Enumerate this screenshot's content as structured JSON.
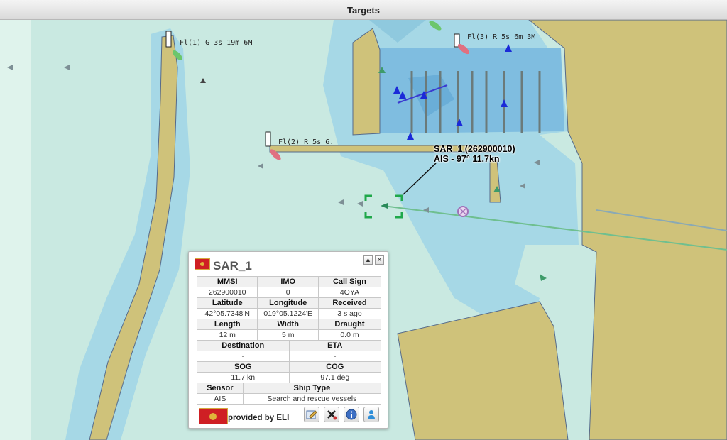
{
  "window": {
    "title": "Targets"
  },
  "map": {
    "light_labels": [
      "Fl(1) G 3s 19m 6M",
      "Fl(3) R 5s 6m 3M",
      "Fl(2) R 5s 6."
    ],
    "target_callout": {
      "line1": "SAR_1 (262900010)",
      "line2": "AIS - 97° 11.7kn"
    }
  },
  "panel": {
    "vessel_name": "SAR_1",
    "rows": [
      {
        "headers": [
          "MMSI",
          "IMO",
          "Call Sign"
        ],
        "values": [
          "262900010",
          "0",
          "4OYA"
        ]
      },
      {
        "headers": [
          "Latitude",
          "Longitude",
          "Received"
        ],
        "values": [
          "42°05.7348'N",
          "019°05.1224'E",
          "3 s ago"
        ]
      },
      {
        "headers": [
          "Length",
          "Width",
          "Draught"
        ],
        "values": [
          "12 m",
          "5 m",
          "0.0 m"
        ]
      },
      {
        "headers": [
          "Destination",
          "ETA"
        ],
        "values": [
          "-",
          "-"
        ]
      },
      {
        "headers": [
          "SOG",
          "COG"
        ],
        "values": [
          "11.7 kn",
          "97.1 deg"
        ]
      },
      {
        "headers": [
          "Sensor",
          "Ship Type"
        ],
        "values": [
          "AIS",
          "Search and rescue vessels"
        ]
      }
    ],
    "footer": {
      "provided_text": "provided by ELI"
    },
    "colors": {
      "flag_red": "#cf1f24",
      "flag_gold": "#e0b43a",
      "selection_green": "#1fa84a"
    }
  }
}
